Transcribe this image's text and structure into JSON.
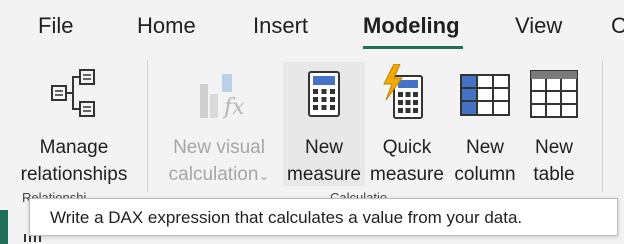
{
  "tabs": [
    {
      "label": "File"
    },
    {
      "label": "Home"
    },
    {
      "label": "Insert"
    },
    {
      "label": "Modeling",
      "active": true
    },
    {
      "label": "View"
    },
    {
      "label": "C"
    }
  ],
  "commands": {
    "manage_relationships": {
      "line1": "Manage",
      "line2": "relationships",
      "icon": "manage-relationships-icon"
    },
    "new_visual_calculation": {
      "line1": "New visual",
      "line2": "calculation",
      "chevron": "⌄",
      "icon": "visual-calculation-icon",
      "disabled": true
    },
    "new_measure": {
      "line1": "New",
      "line2": "measure",
      "icon": "calculator-icon"
    },
    "quick_measure": {
      "line1": "Quick",
      "line2": "measure",
      "icon": "quick-measure-icon"
    },
    "new_column": {
      "line1": "New",
      "line2": "column",
      "icon": "new-column-icon"
    },
    "new_table": {
      "line1": "New",
      "line2": "table",
      "icon": "new-table-icon"
    }
  },
  "groups": {
    "relationships": "Relationshi",
    "calculations": "Calculatio"
  },
  "tooltip": {
    "text": "Write a DAX expression that calculates a value from your data."
  },
  "colors": {
    "accent": "#1e6e5a",
    "table_blue": "#4472c4",
    "lightning": "#f2a900"
  }
}
